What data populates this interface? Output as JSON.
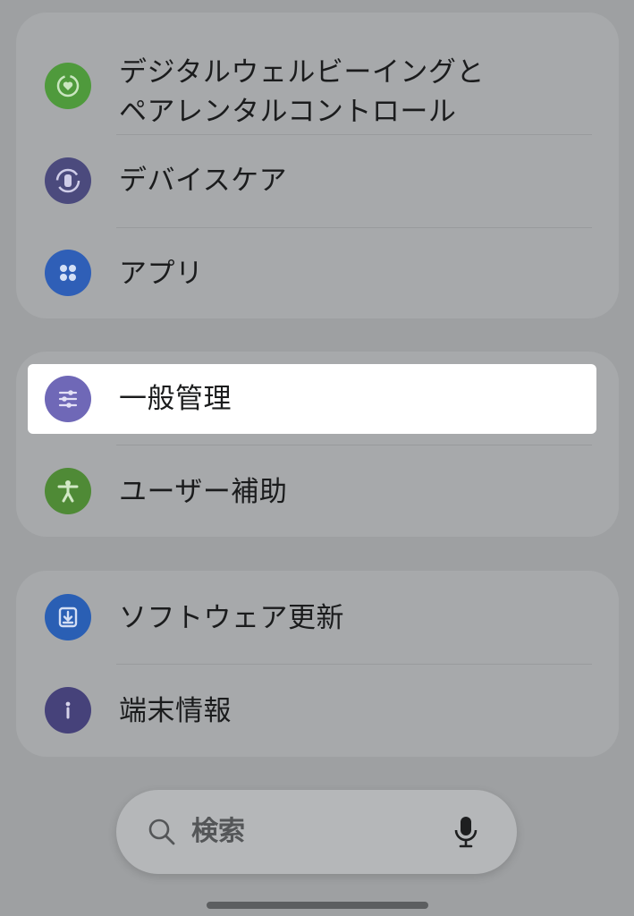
{
  "settings_groups": [
    {
      "items": [
        {
          "label_line1": "デジタルウェルビーイングと",
          "label_line2": "ペアレンタルコントロール",
          "icon": "digital-wellbeing-icon",
          "color": "#4f9a3c"
        },
        {
          "label": "デバイスケア",
          "icon": "device-care-icon",
          "color": "#4b4a7d"
        },
        {
          "label": "アプリ",
          "icon": "apps-icon",
          "color": "#2f5fb7"
        }
      ]
    },
    {
      "items": [
        {
          "label": "一般管理",
          "icon": "general-management-icon",
          "color": "#6f68b7",
          "highlighted": true
        },
        {
          "label": "ユーザー補助",
          "icon": "accessibility-icon",
          "color": "#4f8a36"
        }
      ]
    },
    {
      "items": [
        {
          "label": "ソフトウェア更新",
          "icon": "software-update-icon",
          "color": "#2a5fb4"
        },
        {
          "label": "端末情報",
          "icon": "device-info-icon",
          "color": "#46427a"
        }
      ]
    }
  ],
  "search": {
    "placeholder": "検索",
    "search_icon": "search-icon",
    "mic_icon": "microphone-icon"
  }
}
